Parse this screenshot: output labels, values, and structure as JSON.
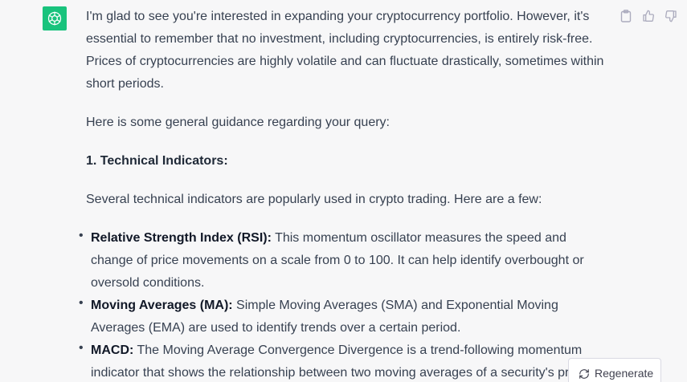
{
  "icons": {
    "avatar": "openai-logo-icon",
    "copy": "clipboard-icon",
    "thumbs_up": "thumbs-up-icon",
    "thumbs_down": "thumbs-down-icon",
    "regenerate": "refresh-icon"
  },
  "colors": {
    "avatar_bg": "#19c37d",
    "page_bg": "#f7f7f8",
    "text": "#374151"
  },
  "message": {
    "intro": "I'm glad to see you're interested in expanding your cryptocurrency portfolio. However, it's essential to remember that no investment, including cryptocurrencies, is entirely risk-free. Prices of cryptocurrencies are highly volatile and can fluctuate drastically, sometimes within short periods.",
    "guidance": "Here is some general guidance regarding your query:",
    "section_heading": "1. Technical Indicators:",
    "section_intro": "Several technical indicators are popularly used in crypto trading. Here are a few:",
    "bullets": [
      {
        "term": "Relative Strength Index (RSI):",
        "text": " This momentum oscillator measures the speed and change of price movements on a scale from 0 to 100. It can help identify overbought or oversold conditions."
      },
      {
        "term": "Moving Averages (MA):",
        "text": " Simple Moving Averages (SMA) and Exponential Moving Averages (EMA) are used to identify trends over a certain period."
      },
      {
        "term": "MACD:",
        "text": " The Moving Average Convergence Divergence is a trend-following momentum indicator that shows the relationship between two moving averages of a security's price."
      }
    ]
  },
  "regenerate_label": "Regenerate"
}
